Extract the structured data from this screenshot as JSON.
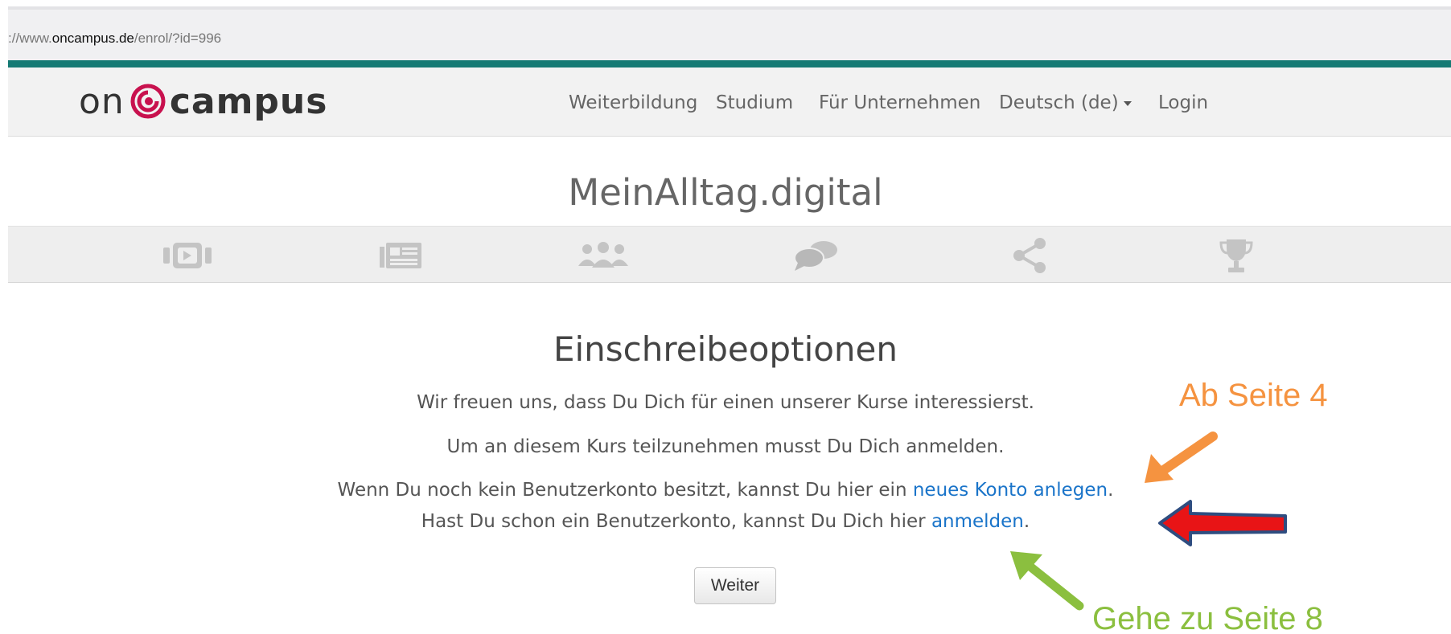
{
  "browser": {
    "url_prefix": "://www.",
    "url_host": "oncampus.de",
    "url_path": "/enrol/?id=996"
  },
  "navbar": {
    "logo_on": "on",
    "logo_campus": "campus",
    "links": [
      "Weiterbildung",
      "Studium",
      "Für Unternehmen",
      "Deutsch (de)",
      "Login"
    ]
  },
  "course": {
    "title": "MeinAlltag.digital",
    "icons": [
      "video-icon",
      "news-icon",
      "group-icon",
      "chat-icon",
      "share-icon",
      "trophy-icon"
    ]
  },
  "enrol": {
    "heading": "Einschreibeoptionen",
    "line1": "Wir freuen uns, dass Du Dich für einen unserer Kurse interessierst.",
    "line2": "Um an diesem Kurs teilzunehmen musst Du Dich anmelden.",
    "line3_before": "Wenn Du noch kein Benutzerkonto besitzt, kannst Du hier ein ",
    "line3_link": "neues Konto anlegen",
    "line3_after": ".",
    "line4_before": "Hast Du schon ein Benutzerkonto, kannst Du Dich hier ",
    "line4_link": "anmelden",
    "line4_after": ".",
    "button": "Weiter"
  },
  "annotations": {
    "orange_text": "Ab Seite 4",
    "green_text": "Gehe zu Seite 8",
    "colors": {
      "orange": "#f59340",
      "red": "#e81416",
      "green": "#8bbf3f",
      "teal": "#157a74",
      "brand": "#c8114e"
    }
  }
}
